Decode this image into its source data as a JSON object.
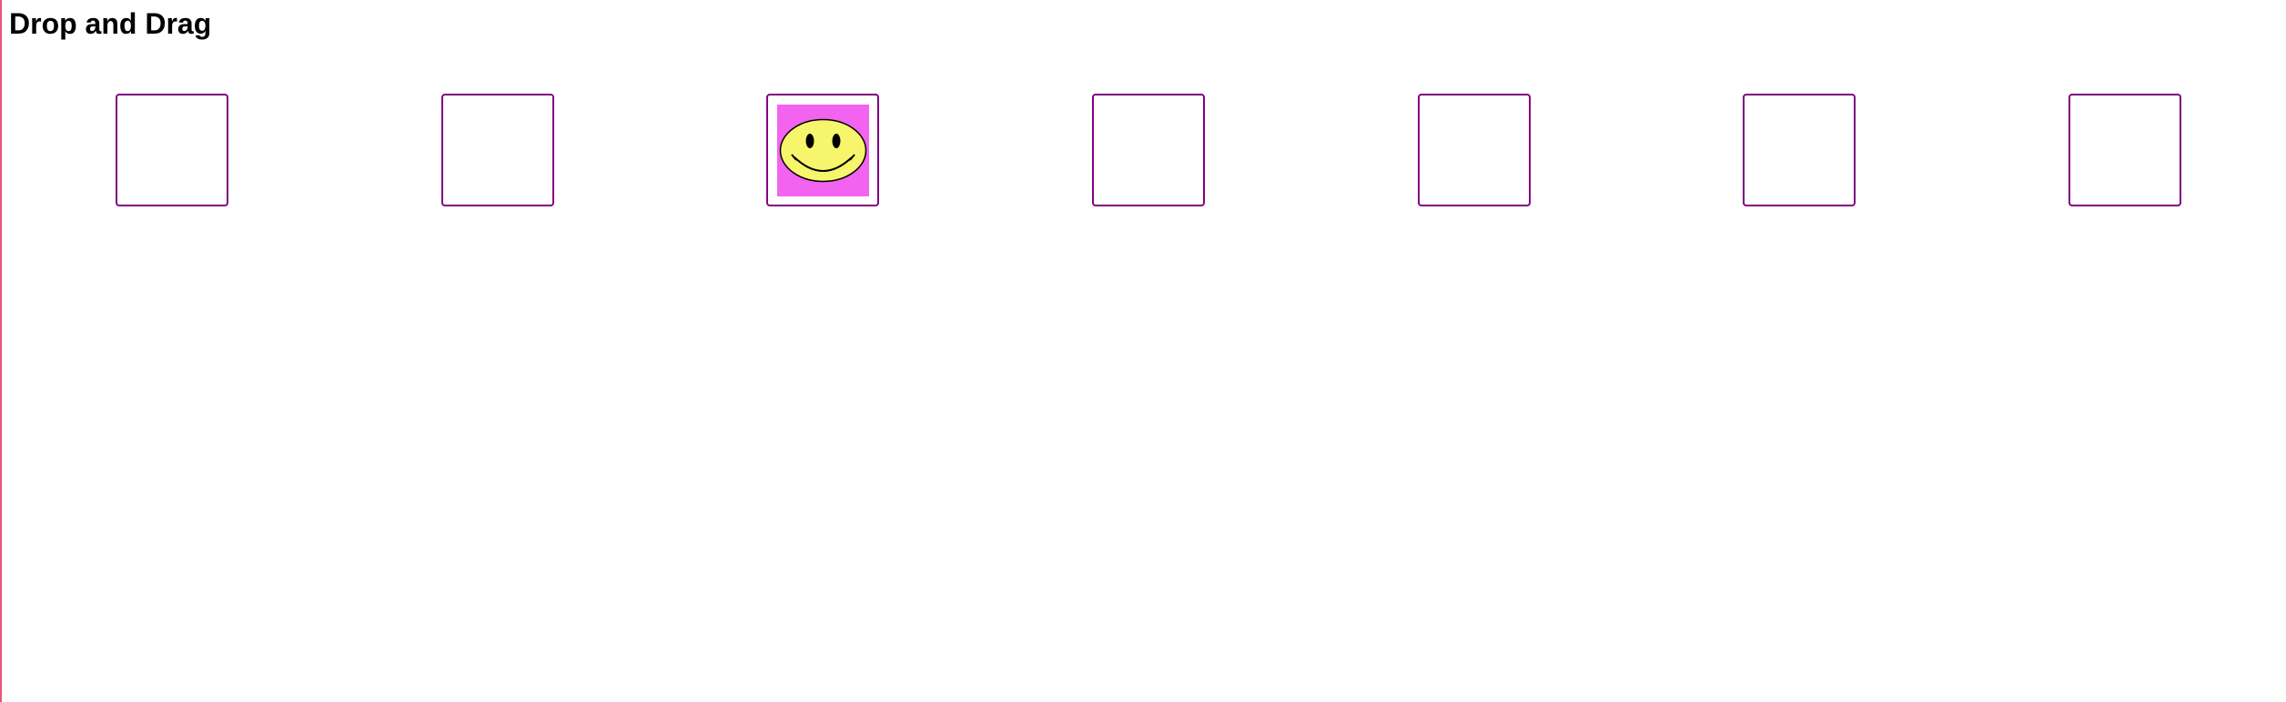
{
  "page": {
    "title": "Drop and Drag"
  },
  "colors": {
    "slot_border": "#800080",
    "token_background": "#f263ef",
    "smiley_face": "#f7f56b",
    "page_edge": "#e8557a"
  },
  "slots": [
    {
      "index": 1,
      "occupied": false
    },
    {
      "index": 2,
      "occupied": false
    },
    {
      "index": 3,
      "occupied": true,
      "content": "smiley-face-icon"
    },
    {
      "index": 4,
      "occupied": false
    },
    {
      "index": 5,
      "occupied": false
    },
    {
      "index": 6,
      "occupied": false
    },
    {
      "index": 7,
      "occupied": false
    }
  ]
}
